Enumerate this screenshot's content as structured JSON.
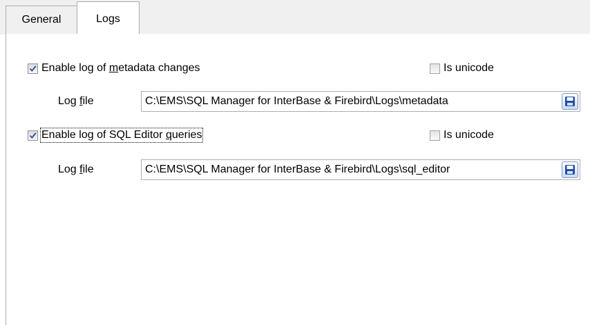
{
  "tabs": [
    {
      "label": "General",
      "active": false
    },
    {
      "label": "Logs",
      "active": true
    }
  ],
  "metadata": {
    "enable_label_pre": "Enable log of ",
    "enable_label_key": "m",
    "enable_label_post": "etadata changes",
    "enable_checked": true,
    "unicode_label": "Is unicode",
    "unicode_checked": false,
    "logfile_label_pre": "Log ",
    "logfile_label_key": "f",
    "logfile_label_post": "ile",
    "logfile_value": "C:\\EMS\\SQL Manager for InterBase & Firebird\\Logs\\metadata"
  },
  "sql": {
    "enable_label_pre": "Enable log of SQL Editor ",
    "enable_label_key": "q",
    "enable_label_post": "ueries",
    "enable_checked": true,
    "unicode_label": "Is unicode",
    "unicode_checked": false,
    "logfile_label_pre": "Log ",
    "logfile_label_key": "f",
    "logfile_label_post": "ile",
    "logfile_value": "C:\\EMS\\SQL Manager for InterBase & Firebird\\Logs\\sql_editor"
  },
  "icons": {
    "save": "floppy-disk-icon",
    "check": "checkmark-icon"
  },
  "colors": {
    "check": "#3a4fa8",
    "floppy": "#1f4fa8"
  }
}
